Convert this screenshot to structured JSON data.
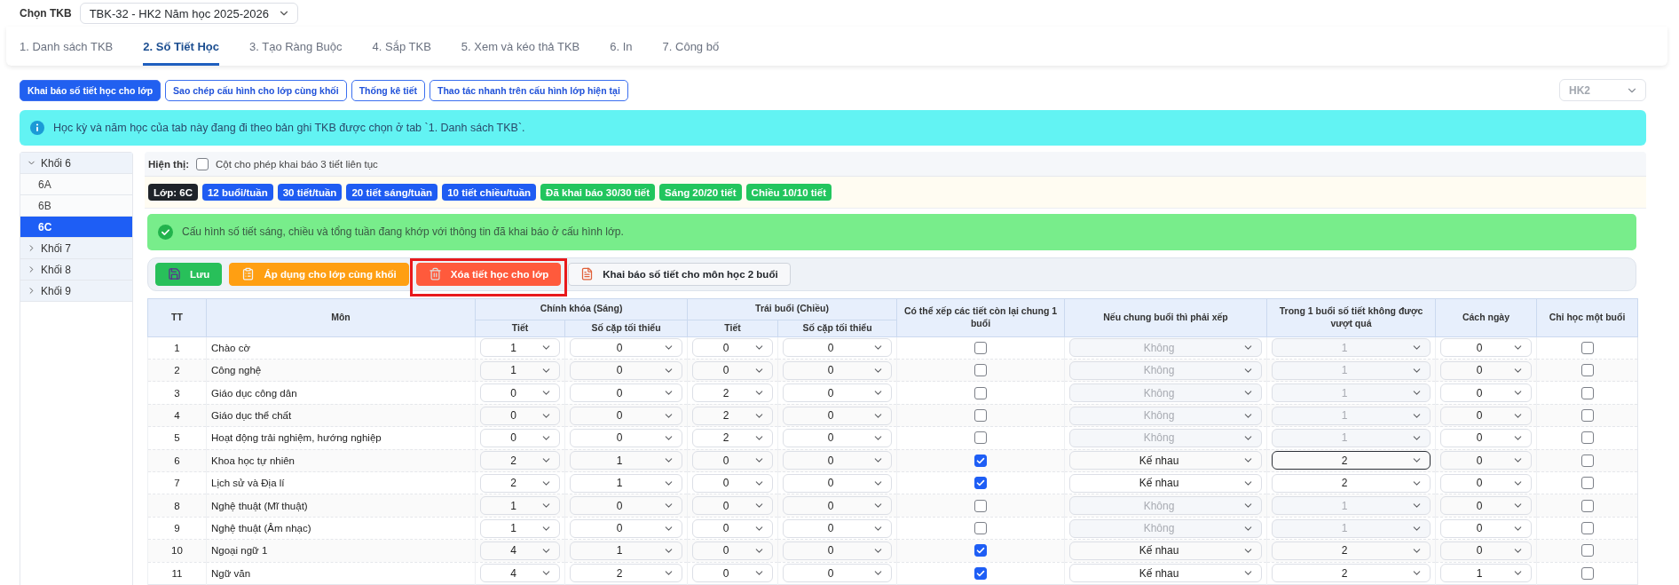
{
  "header": {
    "label": "Chọn TKB",
    "timetable_select": "TBK-32 - HK2 Năm học 2025-2026"
  },
  "tabs": [
    {
      "label": "1. Danh sách TKB",
      "selected": false
    },
    {
      "label": "2. Số Tiết Học",
      "selected": true
    },
    {
      "label": "3. Tạo Ràng Buộc",
      "selected": false
    },
    {
      "label": "4. Sắp TKB",
      "selected": false
    },
    {
      "label": "5. Xem và kéo thả TKB",
      "selected": false
    },
    {
      "label": "6. In",
      "selected": false
    },
    {
      "label": "7. Công bố",
      "selected": false
    }
  ],
  "subtabs": [
    {
      "label": "Khai báo số tiết học cho lớp",
      "selected": true
    },
    {
      "label": "Sao chép cấu hình cho lớp cùng khối",
      "selected": false
    },
    {
      "label": "Thống kê tiết",
      "selected": false
    },
    {
      "label": "Thao tác nhanh trên cấu hình lớp hiện tại",
      "selected": false
    }
  ],
  "semester_select": {
    "value": "HK2",
    "disabled": true
  },
  "info_banner": "Học kỳ và năm học của tab này đang đi theo bản ghi TKB được chọn ở tab `1. Danh sách TKB`.",
  "sidebar": {
    "groups": [
      {
        "label": "Khối 6",
        "expanded": true,
        "children": [
          {
            "label": "6A",
            "selected": false
          },
          {
            "label": "6B",
            "selected": false
          },
          {
            "label": "6C",
            "selected": true
          }
        ]
      },
      {
        "label": "Khối 7",
        "expanded": false
      },
      {
        "label": "Khối 8",
        "expanded": false
      },
      {
        "label": "Khối 9",
        "expanded": false
      }
    ]
  },
  "display_options": {
    "label": "Hiện thị:",
    "option_label": "Cột cho phép khai báo 3 tiết liên tục",
    "checked": false
  },
  "summary_badges": [
    {
      "label": "Lớp: 6C",
      "color": "#1f2329"
    },
    {
      "label": "12 buổi/tuần",
      "color": "#1f5cf2"
    },
    {
      "label": "30 tiết/tuần",
      "color": "#1f5cf2"
    },
    {
      "label": "20 tiết sáng/tuần",
      "color": "#1f5cf2"
    },
    {
      "label": "10 tiết chiều/tuần",
      "color": "#1f5cf2"
    },
    {
      "label": "Đã khai báo 30/30 tiết",
      "color": "#22c55e"
    },
    {
      "label": "Sáng 20/20 tiết",
      "color": "#22c55e"
    },
    {
      "label": "Chiều 10/10 tiết",
      "color": "#22c55e"
    }
  ],
  "success_banner": "Cấu hình số tiết sáng, chiều và tổng tuần đang khớp với thông tin đã khai báo ở cấu hình lớp.",
  "actions": [
    {
      "label": "Lưu",
      "kind": "save",
      "highlighted": false
    },
    {
      "label": "Áp dụng cho lớp cùng khối",
      "kind": "apply",
      "highlighted": false
    },
    {
      "label": "Xóa tiết học cho lớp",
      "kind": "delete",
      "highlighted": true
    },
    {
      "label": "Khai báo số tiết cho môn học 2 buổi",
      "kind": "declare",
      "highlighted": false
    }
  ],
  "table": {
    "columns": [
      {
        "label": "TT"
      },
      {
        "label": "Môn"
      },
      {
        "label": "Chính khóa (Sáng)",
        "children": [
          {
            "label": "Tiết"
          },
          {
            "label": "Số cặp tối thiểu"
          }
        ]
      },
      {
        "label": "Trái buổi (Chiều)",
        "children": [
          {
            "label": "Tiết"
          },
          {
            "label": "Số cặp tối thiểu"
          }
        ]
      },
      {
        "label": "Có thể xếp các tiết còn lại chung 1 buổi"
      },
      {
        "label": "Nếu chung buổi thì phải xếp"
      },
      {
        "label": "Trong 1 buổi số tiết không được vượt quá"
      },
      {
        "label": "Cách ngày"
      },
      {
        "label": "Chỉ học một buổi"
      }
    ],
    "rows": [
      {
        "no": "1",
        "subject": "Chào cờ",
        "morning_periods": "1",
        "morning_min_pairs": "0",
        "afternoon_periods": "0",
        "afternoon_min_pairs": "0",
        "combine_remaining": false,
        "arrangement": {
          "value": "Không",
          "disabled": true
        },
        "max_per_session": {
          "value": "1",
          "disabled": true,
          "focused": false
        },
        "days_apart": "0",
        "one_session_only": false
      },
      {
        "no": "2",
        "subject": "Công nghệ",
        "morning_periods": "1",
        "morning_min_pairs": "0",
        "afternoon_periods": "0",
        "afternoon_min_pairs": "0",
        "combine_remaining": false,
        "arrangement": {
          "value": "Không",
          "disabled": true
        },
        "max_per_session": {
          "value": "1",
          "disabled": true,
          "focused": false
        },
        "days_apart": "0",
        "one_session_only": false
      },
      {
        "no": "3",
        "subject": "Giáo dục công dân",
        "morning_periods": "0",
        "morning_min_pairs": "0",
        "afternoon_periods": "2",
        "afternoon_min_pairs": "0",
        "combine_remaining": false,
        "arrangement": {
          "value": "Không",
          "disabled": true
        },
        "max_per_session": {
          "value": "1",
          "disabled": true,
          "focused": false
        },
        "days_apart": "0",
        "one_session_only": false
      },
      {
        "no": "4",
        "subject": "Giáo dục thể chất",
        "morning_periods": "0",
        "morning_min_pairs": "0",
        "afternoon_periods": "2",
        "afternoon_min_pairs": "0",
        "combine_remaining": false,
        "arrangement": {
          "value": "Không",
          "disabled": true
        },
        "max_per_session": {
          "value": "1",
          "disabled": true,
          "focused": false
        },
        "days_apart": "0",
        "one_session_only": false
      },
      {
        "no": "5",
        "subject": "Hoạt động trải nghiệm, hướng nghiệp",
        "morning_periods": "0",
        "morning_min_pairs": "0",
        "afternoon_periods": "2",
        "afternoon_min_pairs": "0",
        "combine_remaining": false,
        "arrangement": {
          "value": "Không",
          "disabled": true
        },
        "max_per_session": {
          "value": "1",
          "disabled": true,
          "focused": false
        },
        "days_apart": "0",
        "one_session_only": false
      },
      {
        "no": "6",
        "subject": "Khoa học tự nhiên",
        "morning_periods": "2",
        "morning_min_pairs": "1",
        "afternoon_periods": "0",
        "afternoon_min_pairs": "0",
        "combine_remaining": true,
        "arrangement": {
          "value": "Kế nhau",
          "disabled": false
        },
        "max_per_session": {
          "value": "2",
          "disabled": false,
          "focused": true
        },
        "days_apart": "0",
        "one_session_only": false
      },
      {
        "no": "7",
        "subject": "Lịch sử và Địa lí",
        "morning_periods": "2",
        "morning_min_pairs": "1",
        "afternoon_periods": "0",
        "afternoon_min_pairs": "0",
        "combine_remaining": true,
        "arrangement": {
          "value": "Kế nhau",
          "disabled": false
        },
        "max_per_session": {
          "value": "2",
          "disabled": false,
          "focused": false
        },
        "days_apart": "0",
        "one_session_only": false
      },
      {
        "no": "8",
        "subject": "Nghệ thuật (Mĩ thuật)",
        "morning_periods": "1",
        "morning_min_pairs": "0",
        "afternoon_periods": "0",
        "afternoon_min_pairs": "0",
        "combine_remaining": false,
        "arrangement": {
          "value": "Không",
          "disabled": true
        },
        "max_per_session": {
          "value": "1",
          "disabled": true,
          "focused": false
        },
        "days_apart": "0",
        "one_session_only": false
      },
      {
        "no": "9",
        "subject": "Nghệ thuật (Âm nhạc)",
        "morning_periods": "1",
        "morning_min_pairs": "0",
        "afternoon_periods": "0",
        "afternoon_min_pairs": "0",
        "combine_remaining": false,
        "arrangement": {
          "value": "Không",
          "disabled": true
        },
        "max_per_session": {
          "value": "1",
          "disabled": true,
          "focused": false
        },
        "days_apart": "0",
        "one_session_only": false
      },
      {
        "no": "10",
        "subject": "Ngoại ngữ 1",
        "morning_periods": "4",
        "morning_min_pairs": "1",
        "afternoon_periods": "0",
        "afternoon_min_pairs": "0",
        "combine_remaining": true,
        "arrangement": {
          "value": "Kế nhau",
          "disabled": false
        },
        "max_per_session": {
          "value": "2",
          "disabled": false,
          "focused": false
        },
        "days_apart": "0",
        "one_session_only": false
      },
      {
        "no": "11",
        "subject": "Ngữ văn",
        "morning_periods": "4",
        "morning_min_pairs": "2",
        "afternoon_periods": "0",
        "afternoon_min_pairs": "0",
        "combine_remaining": true,
        "arrangement": {
          "value": "Kế nhau",
          "disabled": false
        },
        "max_per_session": {
          "value": "2",
          "disabled": false,
          "focused": false
        },
        "days_apart": "1",
        "one_session_only": false
      }
    ]
  }
}
